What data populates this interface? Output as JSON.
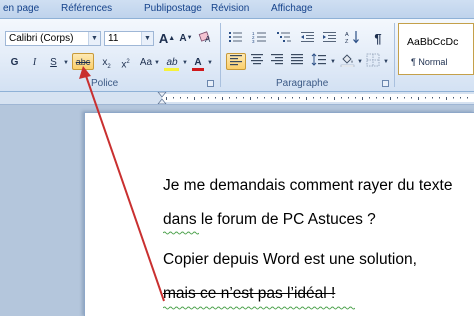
{
  "ribbon": {
    "tabs": [
      "en page",
      "Références",
      "Publipostage",
      "Révision",
      "Affichage"
    ],
    "font_name": "Calibri (Corps)",
    "font_size": "11",
    "grow_font": "A",
    "shrink_font": "A",
    "bold": "G",
    "italic": "I",
    "underline": "S",
    "strikethrough": "abc",
    "subscript": "x",
    "superscript": "x",
    "change_case": "Aa",
    "highlight": "ab",
    "font_color": "A",
    "group_police": "Police",
    "group_paragraphe": "Paragraphe",
    "style_preview": "AaBbCcDc",
    "style_name": "¶ Normal",
    "paragraph_mark": "¶",
    "accent_color": "#c93030"
  },
  "document": {
    "lines": [
      "Je me demandais comment rayer du texte",
      "dans le forum de PC Astuces ?",
      "Copier depuis Word est une solution,",
      "mais ce n’est pas l’idéal !"
    ]
  }
}
